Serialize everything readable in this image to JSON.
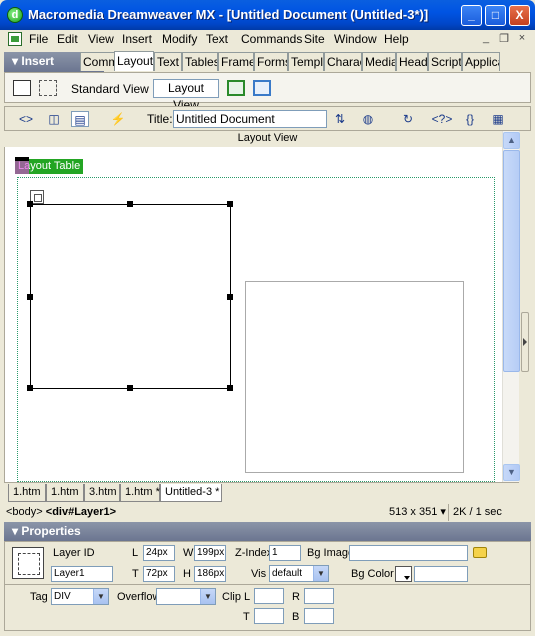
{
  "window": {
    "title": "Macromedia Dreamweaver MX - [Untitled Document (Untitled-3*)]",
    "app_icon_letter": "d",
    "min_symbol": "_",
    "max_symbol": "□",
    "close_symbol": "X"
  },
  "menu": {
    "items": [
      "File",
      "Edit",
      "View",
      "Insert",
      "Modify",
      "Text",
      "Commands",
      "Site",
      "Window",
      "Help"
    ],
    "mdi_min": "_",
    "mdi_restore": "❐",
    "mdi_close": "×"
  },
  "insert_panel": {
    "title": "Insert",
    "tabs": [
      "Comm",
      "Layout",
      "Text",
      "Tables",
      "Frames",
      "Forms",
      "Templ",
      "Charac",
      "Media",
      "Head",
      "Script",
      "Applica"
    ],
    "active_tab": "Layout",
    "standard_view_label": "Standard View",
    "layout_view_label": "Layout View"
  },
  "doc_toolbar": {
    "title_label": "Title:",
    "title_value": "Untitled Document"
  },
  "view_mode_label": "Layout View",
  "canvas": {
    "layout_table_label": "Layout Table"
  },
  "doc_tabs": [
    "1.htm",
    "1.htm",
    "3.htm",
    "1.htm *",
    "Untitled-3 *"
  ],
  "active_doc_tab_index": 4,
  "status": {
    "tag_prefix": "<body>",
    "tag_current": "<div#Layer1>",
    "window_size": "513 x 351",
    "download": "2K / 1 sec"
  },
  "properties": {
    "title": "Properties",
    "layer_id_label": "Layer ID",
    "layer_id_value": "Layer1",
    "l_label": "L",
    "l_value": "24px",
    "t_label": "T",
    "t_value": "72px",
    "w_label": "W",
    "w_value": "199px",
    "h_label": "H",
    "h_value": "186px",
    "zindex_label": "Z-Index",
    "zindex_value": "1",
    "vis_label": "Vis",
    "vis_value": "default",
    "bgimage_label": "Bg Image",
    "bgimage_value": "",
    "bgcolor_label": "Bg Color",
    "bgcolor_value": "",
    "tag_label": "Tag",
    "tag_value": "DIV",
    "overflow_label": "Overflow",
    "overflow_value": "",
    "clip_label": "Clip",
    "clip_l_label": "L",
    "clip_r_label": "R",
    "clip_t_label": "T",
    "clip_b_label": "B"
  }
}
